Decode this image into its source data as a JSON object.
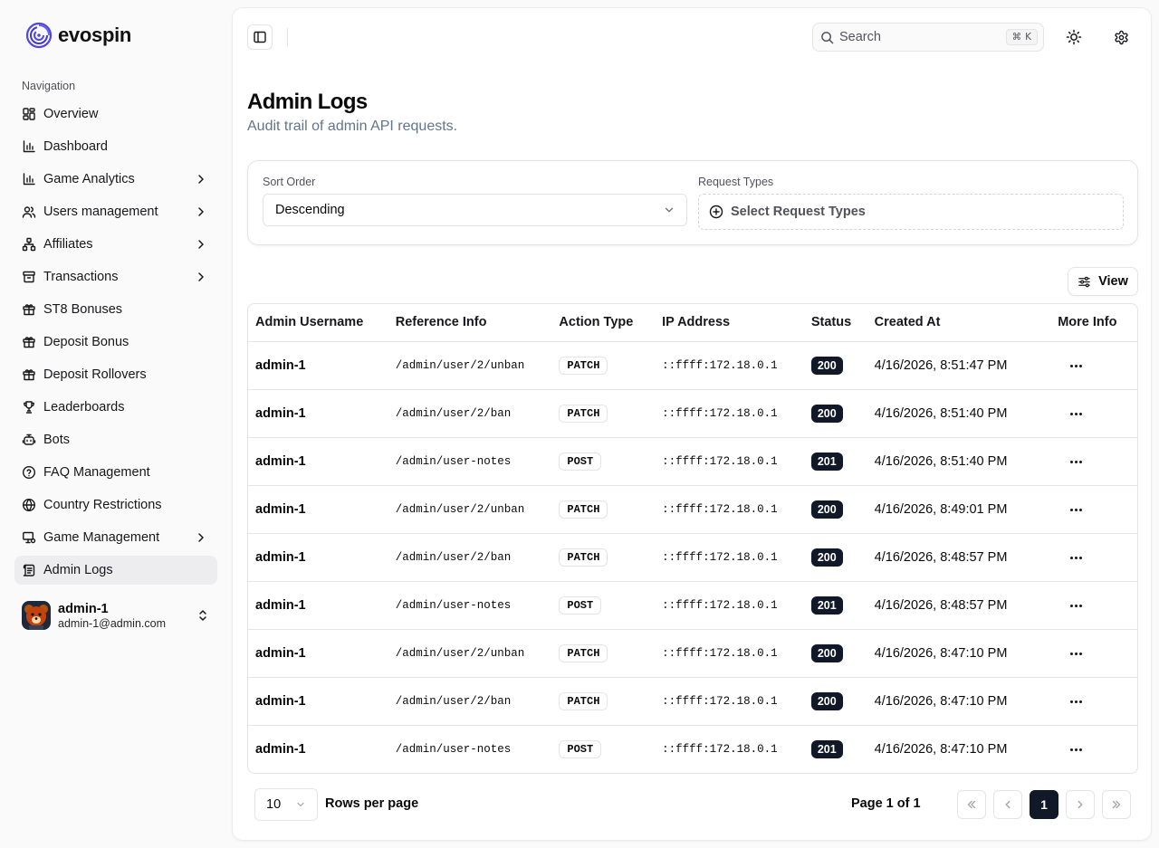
{
  "brand": {
    "name": "evospin"
  },
  "sidebar": {
    "section_title": "Navigation",
    "items": [
      {
        "label": "Overview",
        "icon": "grid-icon",
        "chevron": false
      },
      {
        "label": "Dashboard",
        "icon": "bar-chart-icon",
        "chevron": false
      },
      {
        "label": "Game Analytics",
        "icon": "bar-chart-icon",
        "chevron": true
      },
      {
        "label": "Users management",
        "icon": "users-icon",
        "chevron": true
      },
      {
        "label": "Affiliates",
        "icon": "network-icon",
        "chevron": true
      },
      {
        "label": "Transactions",
        "icon": "archive-icon",
        "chevron": true
      },
      {
        "label": "ST8 Bonuses",
        "icon": "gift-icon",
        "chevron": false
      },
      {
        "label": "Deposit Bonus",
        "icon": "gift-icon",
        "chevron": false
      },
      {
        "label": "Deposit Rollovers",
        "icon": "gift-icon",
        "chevron": false
      },
      {
        "label": "Leaderboards",
        "icon": "trophy-icon",
        "chevron": false
      },
      {
        "label": "Bots",
        "icon": "bot-icon",
        "chevron": false
      },
      {
        "label": "FAQ Management",
        "icon": "help-circle-icon",
        "chevron": false
      },
      {
        "label": "Country Restrictions",
        "icon": "globe-icon",
        "chevron": false
      },
      {
        "label": "Game Management",
        "icon": "monitor-icon",
        "chevron": true
      },
      {
        "label": "Admin Logs",
        "icon": "scroll-text-icon",
        "chevron": false,
        "active": true
      }
    ],
    "user": {
      "name": "admin-1",
      "email": "admin-1@admin.com"
    }
  },
  "header": {
    "search_placeholder": "Search",
    "shortcut_symbol": "⌘",
    "shortcut_key": "K"
  },
  "page": {
    "title": "Admin Logs",
    "subtitle": "Audit trail of admin API requests."
  },
  "filters": {
    "sort_label": "Sort Order",
    "sort_value": "Descending",
    "types_label": "Request Types",
    "types_placeholder": "Select Request Types"
  },
  "view_button": "View",
  "table": {
    "columns": [
      "Admin Username",
      "Reference Info",
      "Action Type",
      "IP Address",
      "Status",
      "Created At",
      "More Info"
    ],
    "rows": [
      {
        "user": "admin-1",
        "ref": "/admin/user/2/unban",
        "action": "PATCH",
        "ip": "::ffff:172.18.0.1",
        "status": "200",
        "created": "4/16/2026, 8:51:47 PM"
      },
      {
        "user": "admin-1",
        "ref": "/admin/user/2/ban",
        "action": "PATCH",
        "ip": "::ffff:172.18.0.1",
        "status": "200",
        "created": "4/16/2026, 8:51:40 PM"
      },
      {
        "user": "admin-1",
        "ref": "/admin/user-notes",
        "action": "POST",
        "ip": "::ffff:172.18.0.1",
        "status": "201",
        "created": "4/16/2026, 8:51:40 PM"
      },
      {
        "user": "admin-1",
        "ref": "/admin/user/2/unban",
        "action": "PATCH",
        "ip": "::ffff:172.18.0.1",
        "status": "200",
        "created": "4/16/2026, 8:49:01 PM"
      },
      {
        "user": "admin-1",
        "ref": "/admin/user/2/ban",
        "action": "PATCH",
        "ip": "::ffff:172.18.0.1",
        "status": "200",
        "created": "4/16/2026, 8:48:57 PM"
      },
      {
        "user": "admin-1",
        "ref": "/admin/user-notes",
        "action": "POST",
        "ip": "::ffff:172.18.0.1",
        "status": "201",
        "created": "4/16/2026, 8:48:57 PM"
      },
      {
        "user": "admin-1",
        "ref": "/admin/user/2/unban",
        "action": "PATCH",
        "ip": "::ffff:172.18.0.1",
        "status": "200",
        "created": "4/16/2026, 8:47:10 PM"
      },
      {
        "user": "admin-1",
        "ref": "/admin/user/2/ban",
        "action": "PATCH",
        "ip": "::ffff:172.18.0.1",
        "status": "200",
        "created": "4/16/2026, 8:47:10 PM"
      },
      {
        "user": "admin-1",
        "ref": "/admin/user-notes",
        "action": "POST",
        "ip": "::ffff:172.18.0.1",
        "status": "201",
        "created": "4/16/2026, 8:47:10 PM"
      }
    ]
  },
  "pagination": {
    "rows_per_page_value": "10",
    "rows_per_page_label": "Rows per page",
    "page_info": "Page 1 of 1",
    "current_page": "1"
  },
  "colors": {
    "brand": "#4f46e5",
    "dark_badge": "#111827",
    "active_nav": "#ededf0"
  }
}
